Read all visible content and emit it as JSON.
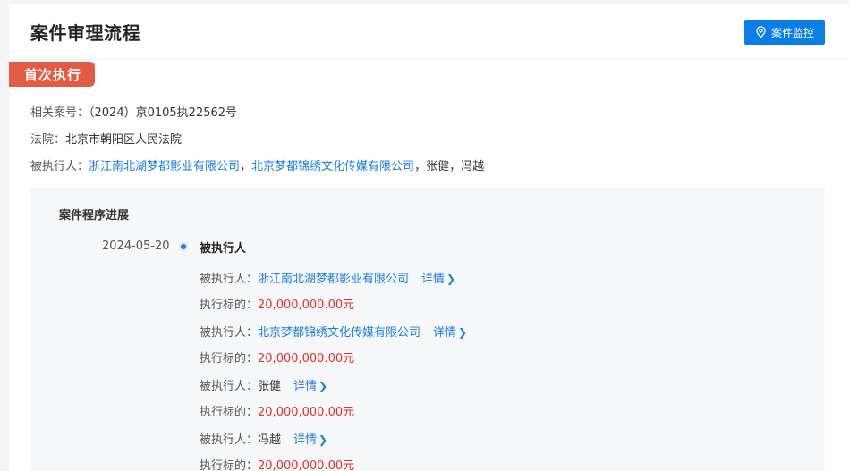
{
  "header": {
    "title": "案件审理流程",
    "monitor_button": "案件监控"
  },
  "ribbon": "首次执行",
  "info": {
    "case_no_label": "相关案号：",
    "case_no": "（2024）京0105执22562号",
    "court_label": "法院：",
    "court": "北京市朝阳区人民法院",
    "debtor_label": "被执行人：",
    "debtor_company1": "浙江南北湖梦都影业有限公司",
    "sep1": "，",
    "debtor_company2": "北京梦都锦绣文化传媒有限公司",
    "debtor_rest": "，张健，冯越"
  },
  "progress": {
    "title": "案件程序进展",
    "date": "2024-05-20",
    "event": "被执行人",
    "entries": [
      {
        "label": "被执行人：",
        "name": "浙江南北湖梦都影业有限公司",
        "is_link": true,
        "detail": "详情",
        "amount_label": "执行标的：",
        "amount": "20,000,000.00元"
      },
      {
        "label": "被执行人：",
        "name": "北京梦都锦绣文化传媒有限公司",
        "is_link": true,
        "detail": "详情",
        "amount_label": "执行标的：",
        "amount": "20,000,000.00元"
      },
      {
        "label": "被执行人：",
        "name": "张健",
        "is_link": false,
        "detail": "详情",
        "amount_label": "执行标的：",
        "amount": "20,000,000.00元"
      },
      {
        "label": "被执行人：",
        "name": "冯越",
        "is_link": false,
        "detail": "详情",
        "amount_label": "执行标的：",
        "amount": "20,000,000.00元"
      }
    ]
  },
  "colors": {
    "accent": "#0a7ee4",
    "ribbon": "#e25b45",
    "amount": "#e0302e",
    "link": "#1c7ee0"
  }
}
